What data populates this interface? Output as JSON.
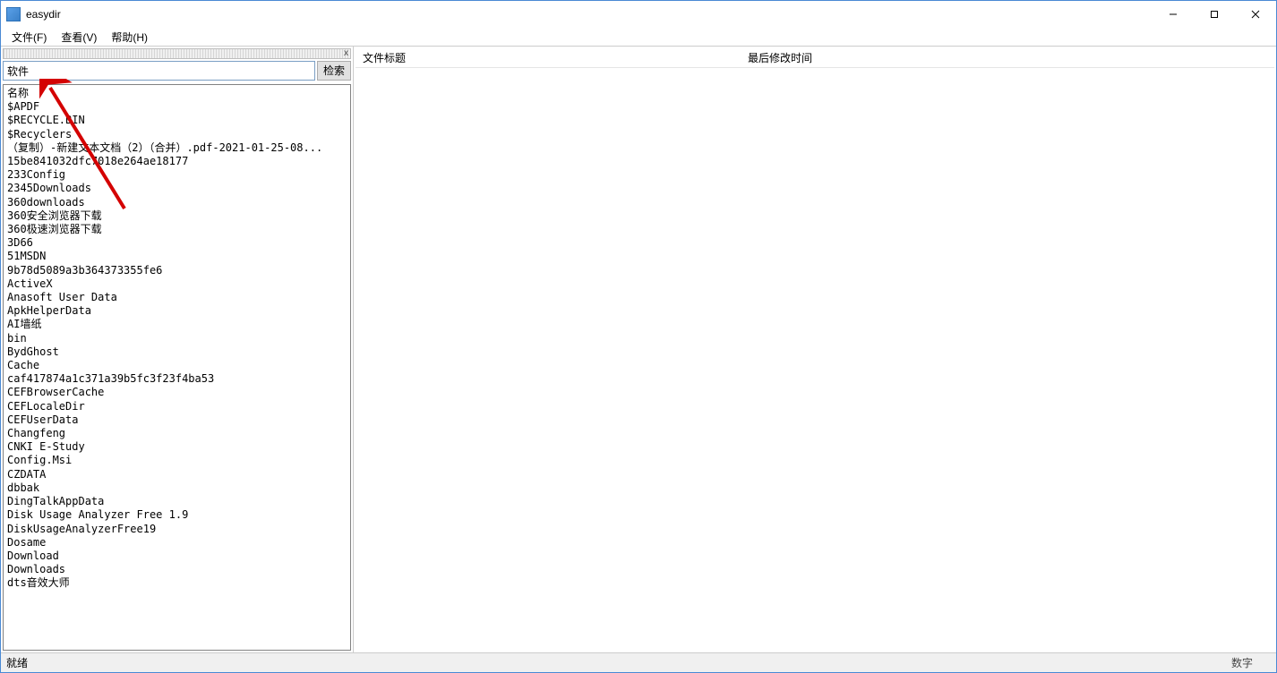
{
  "window": {
    "title": "easydir",
    "minimize": "—",
    "maximize": "☐",
    "close": "✕"
  },
  "menubar": {
    "file": "文件(F)",
    "view": "查看(V)",
    "help": "帮助(H)"
  },
  "left": {
    "strip_close": "x",
    "search_value": "软件",
    "search_button": "检索",
    "list_header": "名称",
    "items": [
      "$APDF",
      "$RECYCLE.BIN",
      "$Recyclers",
      "（复制）-新建文本文档（2）（合并）.pdf-2021-01-25-08...",
      "15be841032dfc7018e264ae18177",
      "233Config",
      "2345Downloads",
      "360downloads",
      "360安全浏览器下载",
      "360极速浏览器下载",
      "3D66",
      "51MSDN",
      "9b78d5089a3b364373355fe6",
      "ActiveX",
      "Anasoft User Data",
      "ApkHelperData",
      "AI墙纸",
      "bin",
      "BydGhost",
      "Cache",
      "caf417874a1c371a39b5fc3f23f4ba53",
      "CEFBrowserCache",
      "CEFLocaleDir",
      "CEFUserData",
      "Changfeng",
      "CNKI E-Study",
      "Config.Msi",
      "CZDATA",
      "dbbak",
      "DingTalkAppData",
      "Disk Usage Analyzer Free 1.9",
      "DiskUsageAnalyzerFree19",
      "Dosame",
      "Download",
      "Downloads",
      "dts音效大师"
    ]
  },
  "right": {
    "col1": "文件标题",
    "col2": "最后修改时间"
  },
  "status": {
    "left": "就绪",
    "right": "数字"
  },
  "annotation_arrow_color": "#d40202"
}
